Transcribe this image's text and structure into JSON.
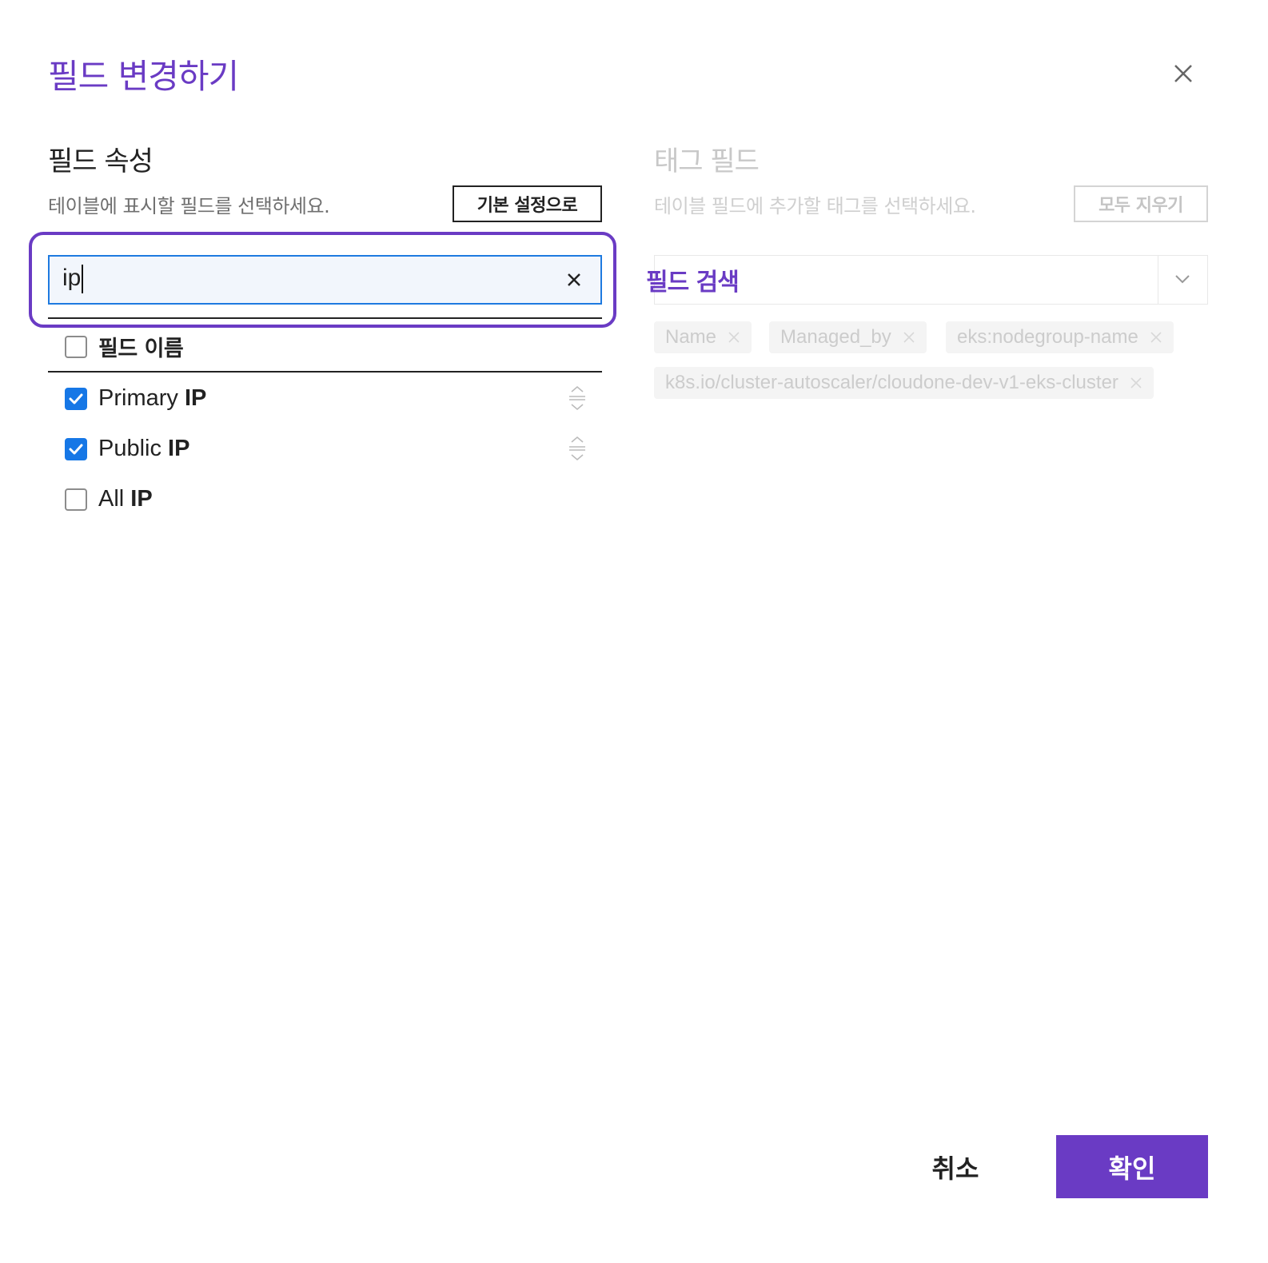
{
  "modal": {
    "title": "필드 변경하기",
    "close_icon": "close-icon"
  },
  "left": {
    "title": "필드 속성",
    "description": "테이블에 표시할 필드를 선택하세요.",
    "reset_button": "기본 설정으로",
    "search": {
      "value": "ip"
    },
    "header_label": "필드 이름",
    "items": [
      {
        "prefix": "Primary ",
        "match": "IP",
        "checked": true
      },
      {
        "prefix": "Public ",
        "match": "IP",
        "checked": true
      },
      {
        "prefix": "All ",
        "match": "IP",
        "checked": false
      }
    ]
  },
  "right": {
    "title": "태그 필드",
    "description": "테이블 필드에 추가할 태그를 선택하세요.",
    "clear_button": "모두 지우기",
    "select_label": "필드 검색",
    "tags": [
      "Name",
      "Managed_by",
      "eks:nodegroup-name",
      "k8s.io/cluster-autoscaler/cloudone-dev-v1-eks-cluster"
    ]
  },
  "footer": {
    "cancel": "취소",
    "confirm": "확인"
  },
  "colors": {
    "accent": "#6a3bc4",
    "checkbox": "#1677e6",
    "input_border": "#1e7ae0"
  }
}
